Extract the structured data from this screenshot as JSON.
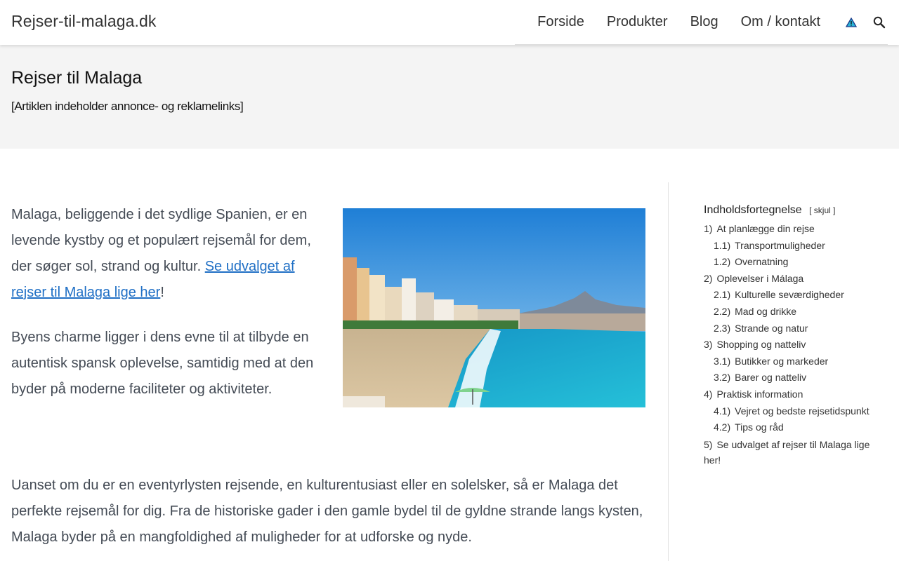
{
  "header": {
    "site_title": "Rejser-til-malaga.dk",
    "nav": [
      {
        "label": "Forside"
      },
      {
        "label": "Produkter"
      },
      {
        "label": "Blog"
      },
      {
        "label": "Om / kontakt"
      }
    ],
    "icons": [
      "warning-icon",
      "search-icon"
    ]
  },
  "hero": {
    "title": "Rejser til Malaga",
    "disclaimer": "[Artiklen indeholder annonce- og reklamelinks]"
  },
  "content": {
    "para1_text": "Malaga, beliggende i det sydlige Spanien, er en levende kystby og et populært rejsemål for dem, der søger sol, strand og kultur. ",
    "para1_link": "Se udvalget af rejser til Malaga lige her",
    "para1_end": "!",
    "para2": "Byens charme ligger i dens evne til at tilbyde en autentisk spansk oplevelse, samtidig med at den byder på moderne faciliteter og aktiviteter.",
    "para3": "Uanset om du er en eventyrlysten rejsende, en kulturentusiast eller en solelsker, så er Malaga det perfekte rejsemål for dig. Fra de historiske gader i den gamle bydel til de gyldne strande langs kysten, Malaga byder på en mangfoldighed af muligheder for at udforske og nyde."
  },
  "toc": {
    "title": "Indholdsfortegnelse",
    "toggle_open": "[",
    "toggle_label": "skjul",
    "toggle_close": "]",
    "items": [
      {
        "num": "1)",
        "label": "At planlægge din rejse"
      },
      {
        "num": "1.1)",
        "label": "Transportmuligheder"
      },
      {
        "num": "1.2)",
        "label": "Overnatning"
      },
      {
        "num": "2)",
        "label": "Oplevelser i Málaga"
      },
      {
        "num": "2.1)",
        "label": "Kulturelle seværdigheder"
      },
      {
        "num": "2.2)",
        "label": "Mad og drikke"
      },
      {
        "num": "2.3)",
        "label": "Strande og natur"
      },
      {
        "num": "3)",
        "label": "Shopping og natteliv"
      },
      {
        "num": "3.1)",
        "label": "Butikker og markeder"
      },
      {
        "num": "3.2)",
        "label": "Barer og natteliv"
      },
      {
        "num": "4)",
        "label": "Praktisk information"
      },
      {
        "num": "4.1)",
        "label": "Vejret og bedste rejsetidspunkt"
      },
      {
        "num": "4.2)",
        "label": "Tips og råd"
      },
      {
        "num": "5)",
        "label": "Se udvalget af rejser til Malaga lige her!"
      }
    ]
  },
  "colors": {
    "link": "#1f6fc5",
    "text": "#444b55",
    "hero_bg": "#f4f4f4",
    "sea": "#1aa3c8",
    "sky": "#2d8fd9"
  }
}
